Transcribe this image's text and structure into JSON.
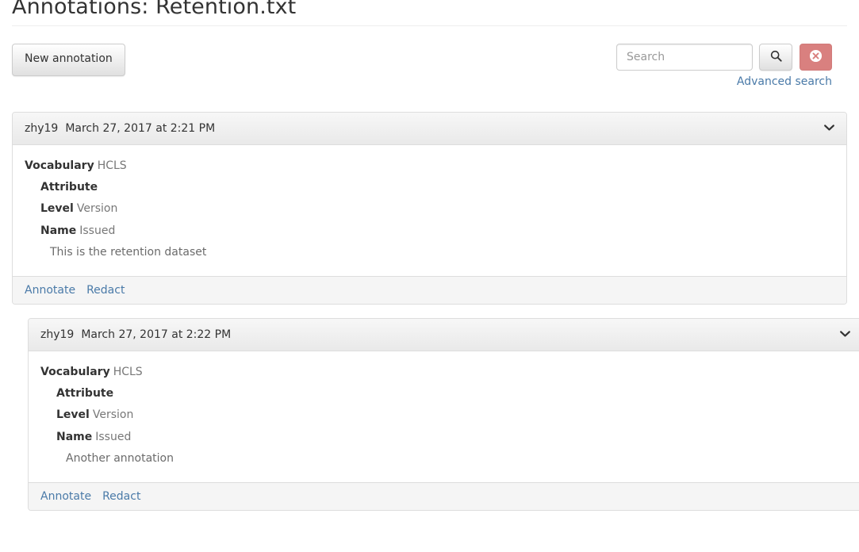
{
  "page": {
    "title": "Annotations: Retention.txt"
  },
  "toolbar": {
    "new_annotation_label": "New annotation",
    "search_placeholder": "Search",
    "search_value": "",
    "search_icon": "search-icon",
    "clear_icon": "remove-circle-icon",
    "advanced_search_label": "Advanced search",
    "clear_button_color": "#d9807f",
    "link_color": "#4a7aa8"
  },
  "annotations": [
    {
      "user": "zhy19",
      "date": "March 27, 2017 at 2:21 PM",
      "collapse_icon": "chevron-down-icon",
      "fields": [
        {
          "label": "Vocabulary",
          "value": "HCLS",
          "indent": 0
        },
        {
          "label": "Attribute",
          "value": "",
          "indent": 1
        },
        {
          "label": "Level",
          "value": "Version",
          "indent": 1
        },
        {
          "label": "Name",
          "value": "Issued",
          "indent": 1
        }
      ],
      "text": "This is the retention dataset",
      "actions": [
        "Annotate",
        "Redact"
      ]
    },
    {
      "user": "zhy19",
      "date": "March 27, 2017 at 2:22 PM",
      "collapse_icon": "chevron-down-icon",
      "fields": [
        {
          "label": "Vocabulary",
          "value": "HCLS",
          "indent": 0
        },
        {
          "label": "Attribute",
          "value": "",
          "indent": 1
        },
        {
          "label": "Level",
          "value": "Version",
          "indent": 1
        },
        {
          "label": "Name",
          "value": "Issued",
          "indent": 1
        }
      ],
      "text": "Another annotation",
      "actions": [
        "Annotate",
        "Redact"
      ]
    }
  ]
}
